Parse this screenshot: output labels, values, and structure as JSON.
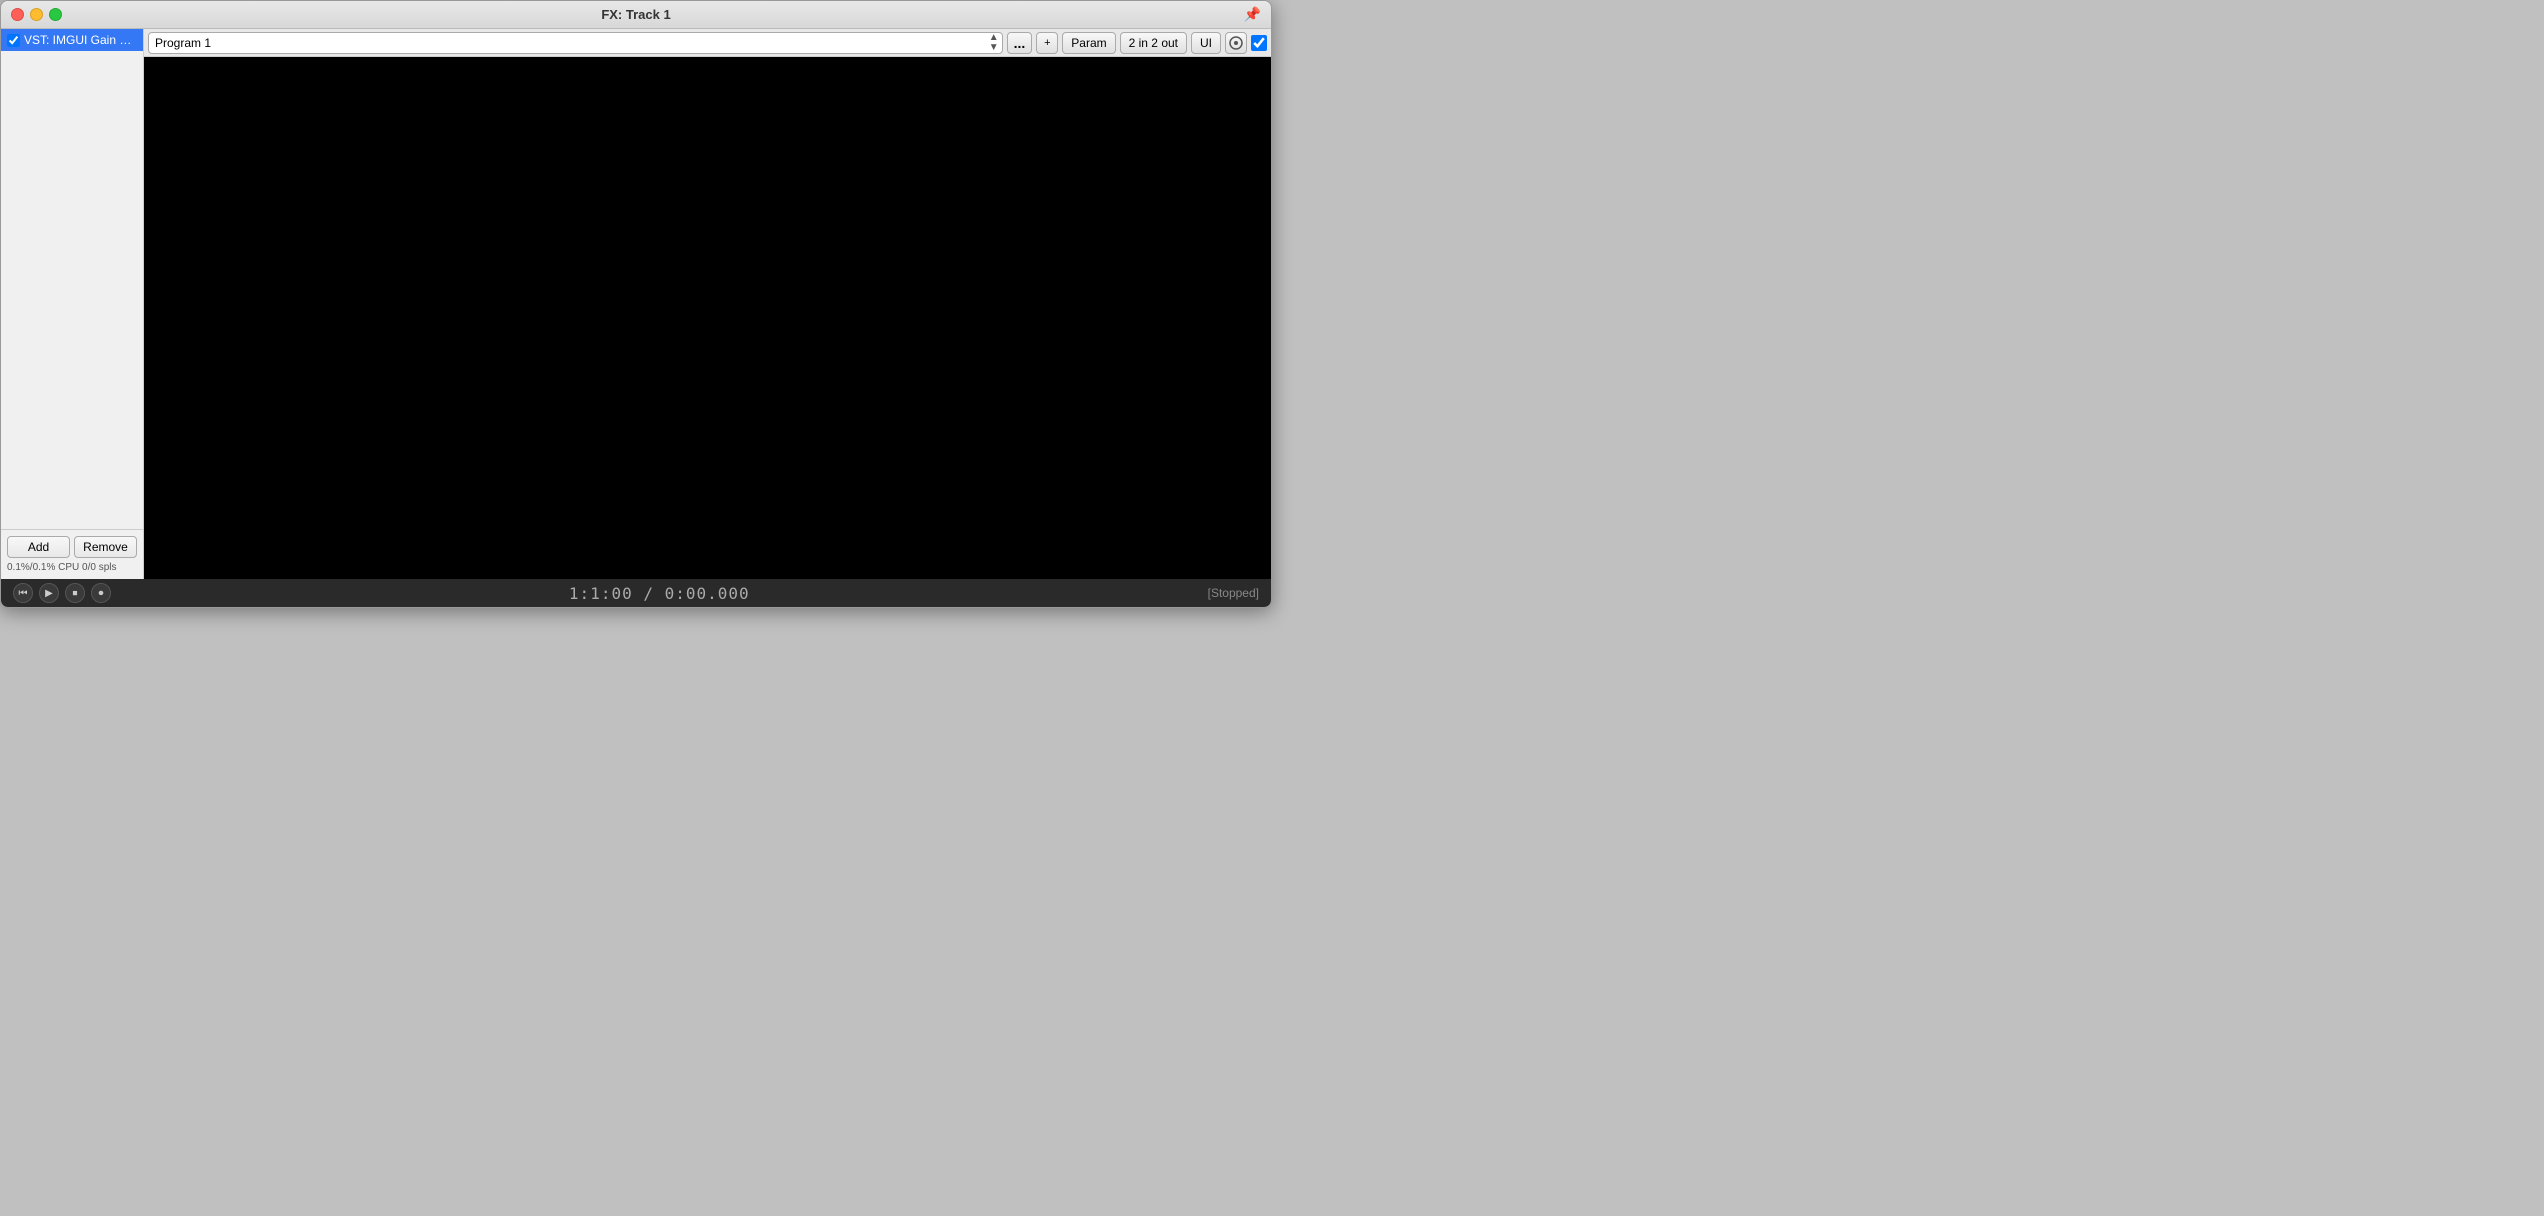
{
  "window": {
    "title": "FX: Track 1"
  },
  "traffic_lights": {
    "close_label": "close",
    "minimize_label": "minimize",
    "maximize_label": "maximize"
  },
  "sidebar": {
    "plugins": [
      {
        "label": "VST: IMGUI Gain Effect in Rust (DGr",
        "checked": true,
        "selected": true
      }
    ],
    "add_button": "Add",
    "remove_button": "Remove",
    "status": "0.1%/0.1% CPU 0/0 spls"
  },
  "toolbar": {
    "program_label": "Program 1",
    "program_placeholder": "Program 1",
    "add_button": "+",
    "param_button": "Param",
    "io_label": "2 in 2 out",
    "ui_button": "UI",
    "more_button": "..."
  },
  "plugin_display": {
    "background": "#000000"
  },
  "transport": {
    "time": "1:1:00 / 0:00.000",
    "status": "[Stopped]"
  }
}
